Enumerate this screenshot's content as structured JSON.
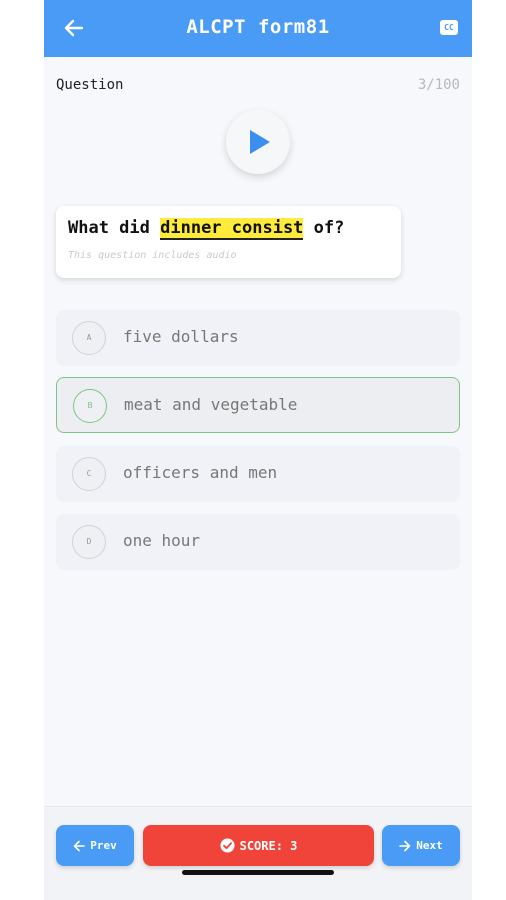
{
  "appbar": {
    "title": "ALCPT form81",
    "cc_label": "CC",
    "back_icon": "arrow-left-icon"
  },
  "question": {
    "label": "Question",
    "progress": "3/100",
    "text_before": "What did ",
    "text_highlight": "dinner consist",
    "text_after": " of?",
    "note": "This question includes audio"
  },
  "options": [
    {
      "letter": "A",
      "text": "five dollars",
      "selected": false
    },
    {
      "letter": "B",
      "text": "meat and vegetable",
      "selected": true
    },
    {
      "letter": "C",
      "text": "officers and men",
      "selected": false
    },
    {
      "letter": "D",
      "text": "one hour",
      "selected": false
    }
  ],
  "footer": {
    "prev_label": "Prev",
    "score_label": "SCORE: 3",
    "next_label": "Next"
  },
  "colors": {
    "primary": "#4a9bf5",
    "score": "#f0443a",
    "highlight": "#ffeb3b",
    "selected_border": "#7fc486"
  }
}
